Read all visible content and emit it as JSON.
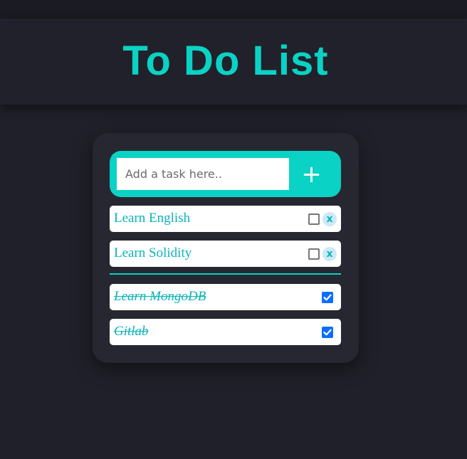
{
  "header": {
    "title": "To Do List"
  },
  "form": {
    "placeholder": "Add a task here..",
    "add_label": "+"
  },
  "pending_tasks": [
    {
      "label": "Learn English",
      "checked": false,
      "delete_label": "x"
    },
    {
      "label": "Learn Solidity",
      "checked": false,
      "delete_label": "x"
    }
  ],
  "completed_tasks": [
    {
      "label": "Learn MongoDB",
      "checked": true
    },
    {
      "label": "Gitlab",
      "checked": true
    }
  ],
  "colors": {
    "accent": "#0ad2c4",
    "background": "#1f2029",
    "card": "#262730",
    "checkbox_checked": "#0d6efd"
  }
}
